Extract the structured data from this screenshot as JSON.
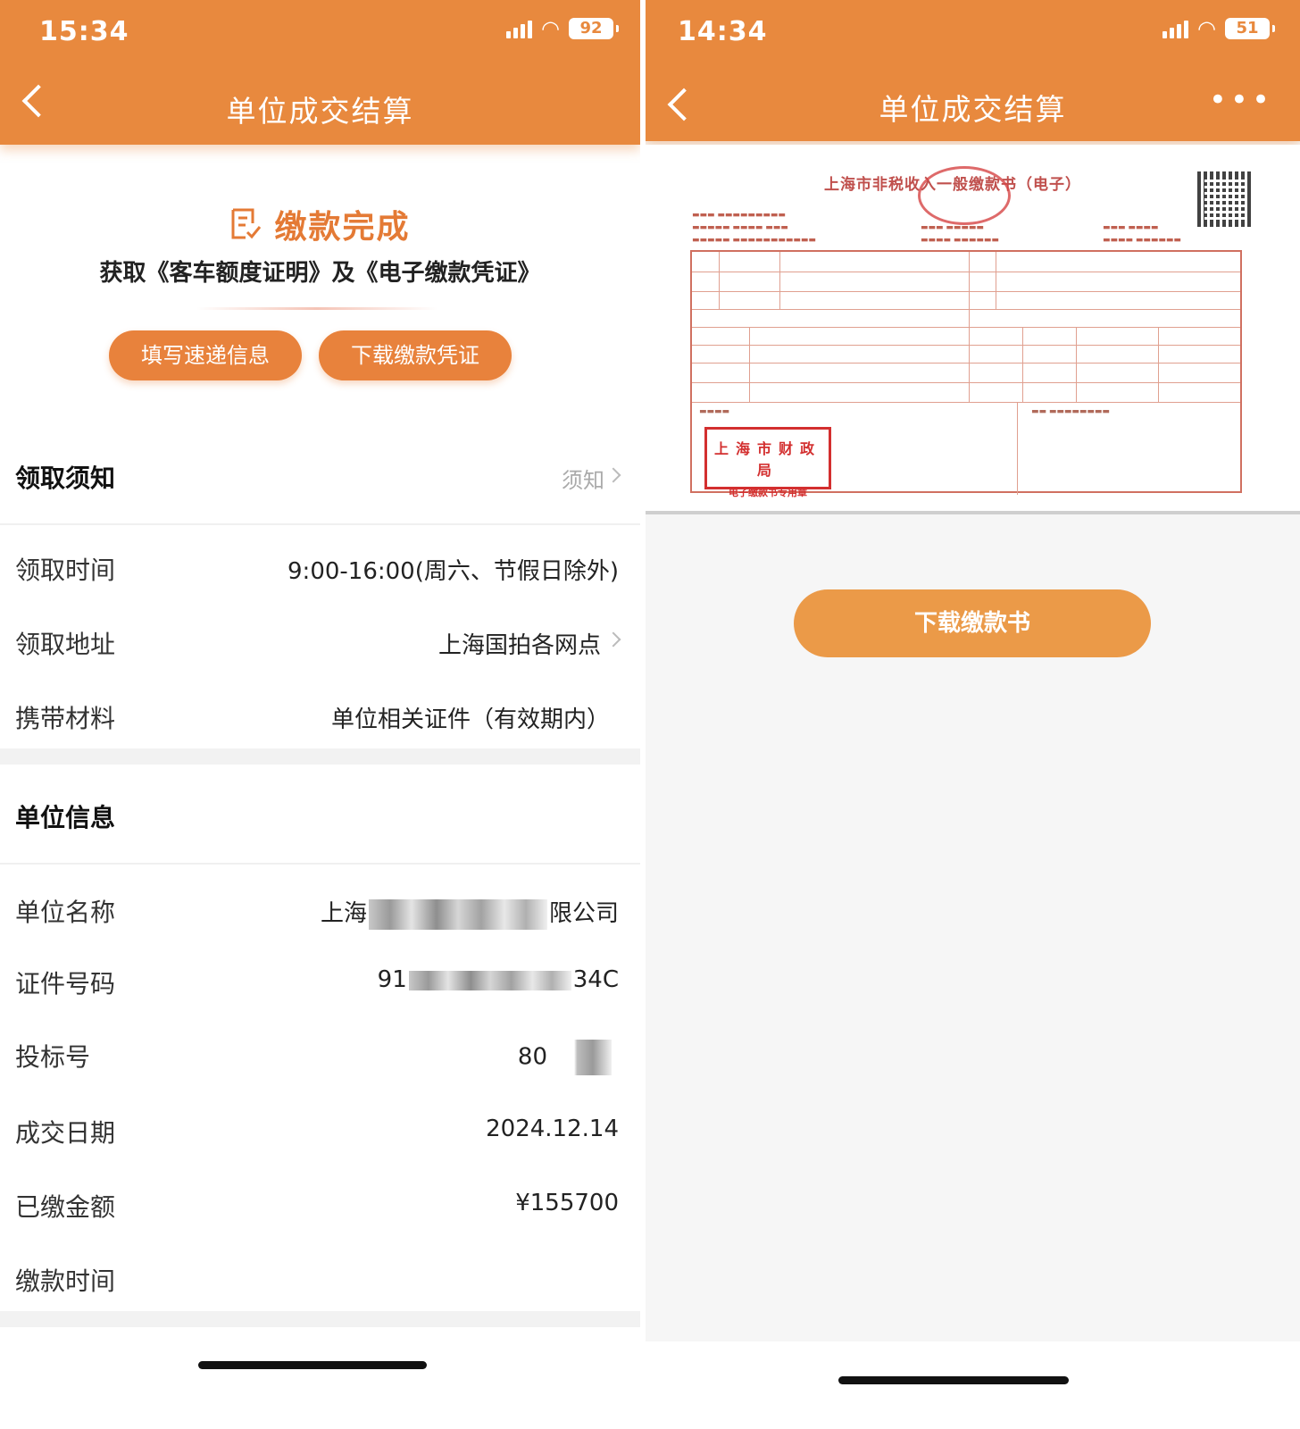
{
  "left": {
    "status": {
      "time": "15:34",
      "battery": "92"
    },
    "nav": {
      "title": "单位成交结算"
    },
    "success": {
      "title": "缴款完成",
      "subtitle": "获取《客车额度证明》及《电子缴款凭证》"
    },
    "buttons": {
      "fill_courier": "填写速递信息",
      "download_voucher": "下载缴款凭证"
    },
    "pickup": {
      "heading": "领取须知",
      "link": "须知",
      "rows": [
        {
          "label": "领取时间",
          "value": "9:00-16:00(周六、节假日除外)"
        },
        {
          "label": "领取地址",
          "value": "上海国拍各网点"
        },
        {
          "label": "携带材料",
          "value": "单位相关证件（有效期内）"
        }
      ]
    },
    "company": {
      "heading": "单位信息",
      "name_label": "单位名称",
      "name_prefix": "上海",
      "name_suffix": "限公司",
      "id_label": "证件号码",
      "id_prefix": "91",
      "id_suffix": "34C",
      "bid_label": "投标号",
      "bid_prefix": "80",
      "date_label": "成交日期",
      "date_value": "2024.12.14",
      "paid_label": "已缴金额",
      "paid_value": "¥155700",
      "paytime_label": "缴款时间",
      "paytime_value": ""
    }
  },
  "right": {
    "status": {
      "time": "14:34",
      "battery": "51"
    },
    "nav": {
      "title": "单位成交结算"
    },
    "receipt": {
      "title": "上海市非税收入一般缴款书（电子）",
      "stamp_line1": "上海市财政局",
      "stamp_line2": "电子缴款书专用章"
    },
    "download_label": "下载缴款书"
  },
  "colors": {
    "accent": "#e8893e",
    "button": "#e8823c",
    "success_text": "#e47a35"
  },
  "icons": [
    "back-chevron-icon",
    "more-dots-icon",
    "signal-icon",
    "wifi-icon",
    "battery-icon",
    "receipt-check-icon",
    "chevron-right-icon"
  ]
}
